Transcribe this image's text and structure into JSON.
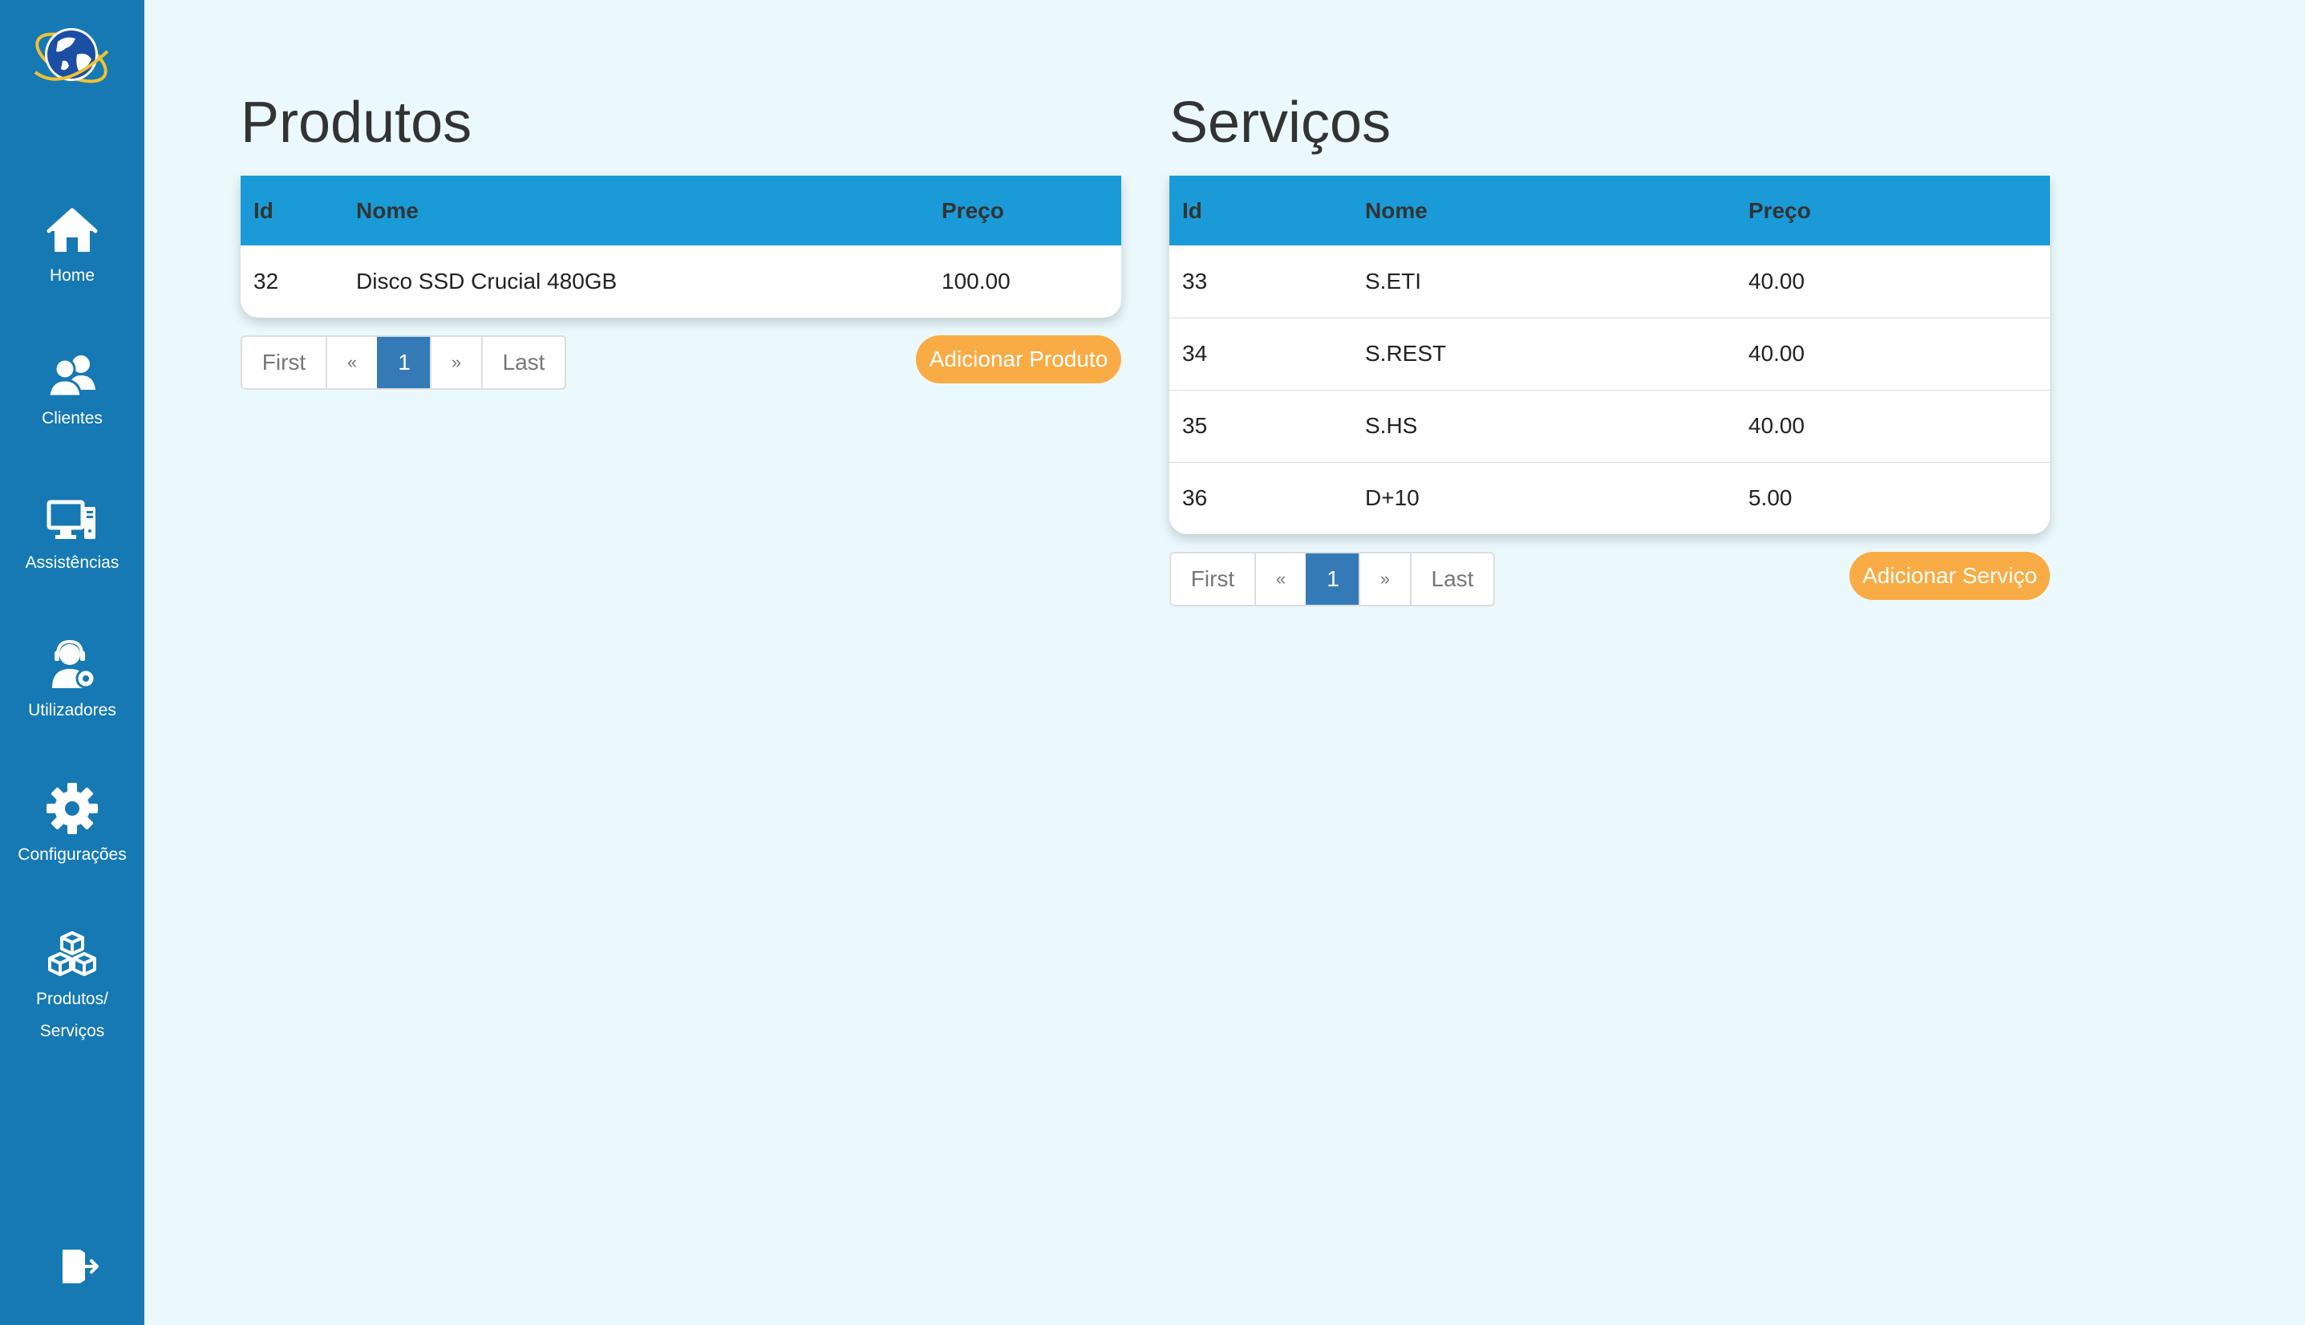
{
  "sidebar": {
    "items": [
      {
        "label": "Home",
        "icon": "home-icon"
      },
      {
        "label": "Clientes",
        "icon": "users-icon"
      },
      {
        "label": "Assistências",
        "icon": "computer-icon"
      },
      {
        "label": "Utilizadores",
        "icon": "support-agent-icon"
      },
      {
        "label": "Configurações",
        "icon": "gear-icon"
      },
      {
        "label_line1": "Produtos/",
        "label_line2": "Serviços",
        "icon": "boxes-icon"
      }
    ],
    "logout_icon": "logout-icon",
    "logo_icon": "globe-logo-icon"
  },
  "produtos": {
    "title": "Produtos",
    "columns": {
      "id": "Id",
      "nome": "Nome",
      "preco": "Preço"
    },
    "rows": [
      {
        "id": "32",
        "nome": "Disco SSD Crucial 480GB",
        "preco": "100.00"
      }
    ],
    "pager": {
      "first": "First",
      "prev": "«",
      "current": "1",
      "next": "»",
      "last": "Last"
    },
    "add_button": "Adicionar Produto"
  },
  "servicos": {
    "title": "Serviços",
    "columns": {
      "id": "Id",
      "nome": "Nome",
      "preco": "Preço"
    },
    "rows": [
      {
        "id": "33",
        "nome": "S.ETI",
        "preco": "40.00"
      },
      {
        "id": "34",
        "nome": "S.REST",
        "preco": "40.00"
      },
      {
        "id": "35",
        "nome": "S.HS",
        "preco": "40.00"
      },
      {
        "id": "36",
        "nome": "D+10",
        "preco": "5.00"
      }
    ],
    "pager": {
      "first": "First",
      "prev": "«",
      "current": "1",
      "next": "»",
      "last": "Last"
    },
    "add_button": "Adicionar Serviço"
  },
  "colors": {
    "sidebar": "#1679b3",
    "background": "#ebf9fd",
    "table_header": "#1a9bd7",
    "pager_active": "#337ab7",
    "add_button": "#f9ac45"
  }
}
